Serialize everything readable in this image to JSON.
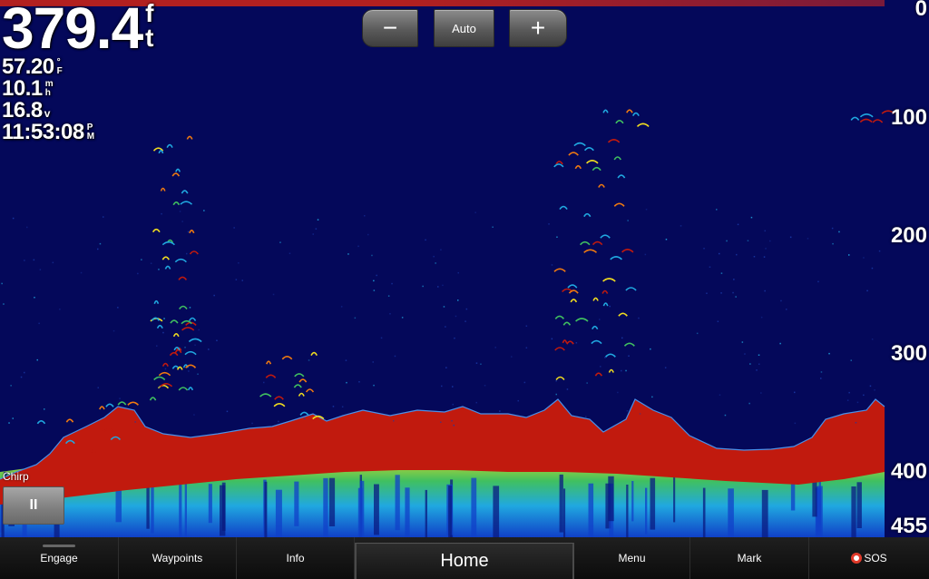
{
  "readouts": {
    "depth": {
      "value": "379.4",
      "unit_top": "f",
      "unit_bottom": "t"
    },
    "water_temp": {
      "value": "57.20",
      "unit_top": "°",
      "unit_bottom": "F"
    },
    "speed": {
      "value": "10.1",
      "unit_top": "m",
      "unit_bottom": "h"
    },
    "voltage": {
      "value": "16.8",
      "unit": "v"
    },
    "time": {
      "value": "11:53:08",
      "unit_top": "P",
      "unit_bottom": "M"
    }
  },
  "zoom": {
    "minus_label": "−",
    "auto_label": "Auto",
    "plus_label": "+"
  },
  "depth_scale": [
    "0",
    "100",
    "200",
    "300",
    "400",
    "455"
  ],
  "sonar": {
    "mode_label": "Chirp",
    "pause_label": "II",
    "colors": {
      "water": "#04085a",
      "bottom": "#c11a0e",
      "orange": "#f07a10",
      "yellow": "#f0dc20",
      "green": "#40c060",
      "cyan": "#20a8e0",
      "blue": "#1040c8"
    }
  },
  "bottom_bar": {
    "items": [
      "Engage",
      "Waypoints",
      "Info",
      "Home",
      "Menu",
      "Mark",
      "SOS"
    ]
  }
}
